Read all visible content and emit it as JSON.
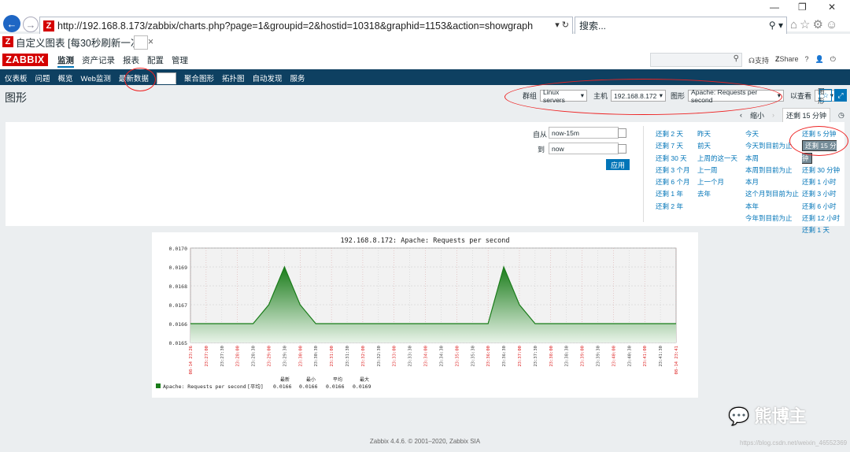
{
  "browser": {
    "url": "http://192.168.8.173/zabbix/charts.php?page=1&groupid=2&hostid=10318&graphid=1153&action=showgraph",
    "search_placeholder": "搜索...",
    "tab_title": "自定义图表 [每30秒刷新一次]",
    "tab_close": "×",
    "favicon_letter": "Z"
  },
  "header": {
    "logo": "ZABBIX",
    "menu": [
      "监测",
      "资产记录",
      "报表",
      "配置",
      "管理"
    ],
    "support": "支持",
    "share": "Share",
    "help": "?"
  },
  "subnav": [
    "仪表板",
    "问题",
    "概览",
    "Web监测",
    "最新数据",
    "图形",
    "聚合图形",
    "拓扑图",
    "自动发现",
    "服务"
  ],
  "page": {
    "title": "图形",
    "filters": {
      "group_label": "群组",
      "group_value": "Linux servers",
      "host_label": "主机",
      "host_value": "192.168.8.172",
      "graph_label": "图形",
      "graph_value": "Apache: Requests per second",
      "view_label": "以查看",
      "view_value": "图形"
    }
  },
  "timebar": {
    "zoom_out": "缩小",
    "current": "还剩 15 分钟"
  },
  "time_filter": {
    "from_label": "自从",
    "from_value": "now-15m",
    "to_label": "到",
    "to_value": "now",
    "apply": "应用",
    "col1": [
      "还剩 2 天",
      "还剩 7 天",
      "还剩 30 天",
      "还剩 3 个月",
      "还剩 6 个月",
      "还剩 1 年",
      "还剩 2 年"
    ],
    "col2": [
      "昨天",
      "前天",
      "上周的这一天",
      "上一周",
      "上一个月",
      "去年"
    ],
    "col3": [
      "今天",
      "今天到目前为止",
      "本周",
      "本周到目前为止",
      "本月",
      "这个月到目前为止",
      "本年",
      "今年到目前为止"
    ],
    "col4": [
      "还剩 5 分钟",
      "还剩 15 分钟",
      "还剩 30 分钟",
      "还剩 1 小时",
      "还剩 3 小时",
      "还剩 6 小时",
      "还剩 12 小时",
      "还剩 1 天"
    ]
  },
  "chart_data": {
    "type": "area",
    "title": "192.168.8.172: Apache: Requests per second",
    "ylim": [
      0.0165,
      0.017
    ],
    "yticks": [
      "0.0170",
      "0.0169",
      "0.0168",
      "0.0167",
      "0.0166",
      "0.0165"
    ],
    "x": [
      "23:26:43",
      "23:27:03",
      "23:27:33",
      "23:28:03",
      "23:28:33",
      "23:29:03",
      "23:29:33",
      "23:30:03",
      "23:30:33",
      "23:31:03",
      "23:31:33",
      "23:32:03",
      "23:32:33",
      "23:33:03",
      "23:33:33",
      "23:34:03",
      "23:34:33",
      "23:35:03",
      "23:35:33",
      "23:36:03",
      "23:36:33",
      "23:37:03",
      "23:37:33",
      "23:38:03",
      "23:38:33",
      "23:39:03",
      "23:39:33",
      "23:40:03",
      "23:40:33",
      "23:41:03",
      "23:41:33",
      "23:41:43"
    ],
    "series": [
      {
        "name": "Apache: Requests per second",
        "values": [
          0.0166,
          0.0166,
          0.0166,
          0.0166,
          0.0166,
          0.0167,
          0.0169,
          0.0167,
          0.0166,
          0.0166,
          0.0166,
          0.0166,
          0.0166,
          0.0166,
          0.0166,
          0.0166,
          0.0166,
          0.0166,
          0.0166,
          0.0166,
          0.0169,
          0.0167,
          0.0166,
          0.0166,
          0.0166,
          0.0166,
          0.0166,
          0.0166,
          0.0166,
          0.0166,
          0.0166,
          0.0166
        ]
      }
    ],
    "xtick_labels": [
      {
        "text": "08-14 23:26",
        "red": true
      },
      {
        "text": "23:27:00",
        "red": true
      },
      {
        "text": "23:27:30",
        "red": false
      },
      {
        "text": "23:28:00",
        "red": true
      },
      {
        "text": "23:28:30",
        "red": false
      },
      {
        "text": "23:29:00",
        "red": true
      },
      {
        "text": "23:29:30",
        "red": false
      },
      {
        "text": "23:30:00",
        "red": true
      },
      {
        "text": "23:30:30",
        "red": false
      },
      {
        "text": "23:31:00",
        "red": true
      },
      {
        "text": "23:31:30",
        "red": false
      },
      {
        "text": "23:32:00",
        "red": true
      },
      {
        "text": "23:32:30",
        "red": false
      },
      {
        "text": "23:33:00",
        "red": true
      },
      {
        "text": "23:33:30",
        "red": false
      },
      {
        "text": "23:34:00",
        "red": true
      },
      {
        "text": "23:34:30",
        "red": false
      },
      {
        "text": "23:35:00",
        "red": true
      },
      {
        "text": "23:35:30",
        "red": false
      },
      {
        "text": "23:36:00",
        "red": true
      },
      {
        "text": "23:36:30",
        "red": false
      },
      {
        "text": "23:37:00",
        "red": true
      },
      {
        "text": "23:37:30",
        "red": false
      },
      {
        "text": "23:38:00",
        "red": true
      },
      {
        "text": "23:38:30",
        "red": false
      },
      {
        "text": "23:39:00",
        "red": true
      },
      {
        "text": "23:39:30",
        "red": false
      },
      {
        "text": "23:40:00",
        "red": true
      },
      {
        "text": "23:40:30",
        "red": false
      },
      {
        "text": "23:41:00",
        "red": true
      },
      {
        "text": "23:41:30",
        "red": false
      },
      {
        "text": "08-14 23:41",
        "red": true
      }
    ],
    "legend": {
      "name": "Apache: Requests per second",
      "func": "[平均]",
      "headers": [
        "最新",
        "最小",
        "平均",
        "最大"
      ],
      "values": [
        "0.0166",
        "0.0166",
        "0.0166",
        "0.0169"
      ]
    },
    "colors": {
      "series": "#1a7c1a",
      "grid": "#c8c8c8",
      "redtick": "#dd2222"
    }
  },
  "footer": "Zabbix 4.4.6. © 2001–2020, Zabbix SIA",
  "watermark": "熊博主",
  "watermark_url": "https://blog.csdn.net/weixin_46552369"
}
